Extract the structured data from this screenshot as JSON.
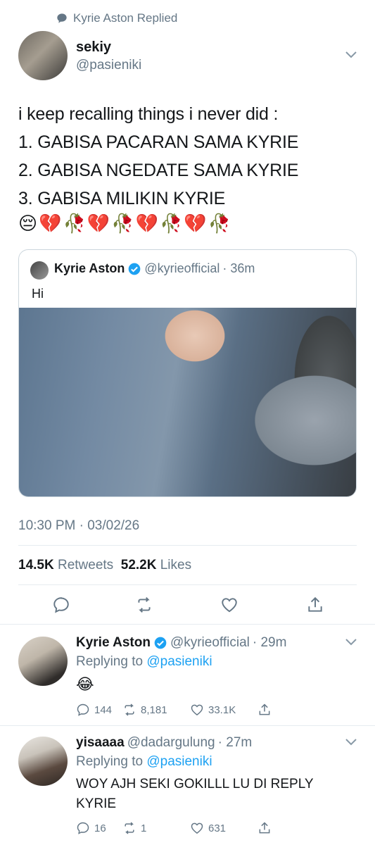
{
  "context": {
    "replied_label": "Kyrie Aston Replied"
  },
  "main_tweet": {
    "name": "sekiy",
    "handle": "@pasieniki",
    "lines": [
      "i keep recalling things i never did :",
      "1. GABISA PACARAN SAMA KYRIE",
      "2. GABISA NGEDATE SAMA KYRIE",
      "3. GABISA MILIKIN KYRIE"
    ],
    "emojis": "😔💔🥀💔🥀💔🥀💔🥀",
    "timestamp": "10:30 PM · 03/02/26",
    "retweets_count": "14.5K",
    "retweets_label": "Retweets",
    "likes_count": "52.2K",
    "likes_label": "Likes"
  },
  "quoted_tweet": {
    "name": "Kyrie Aston",
    "handle": "@kyrieofficial",
    "time": "· 36m",
    "text": "Hi"
  },
  "replies": [
    {
      "name": "Kyrie Aston",
      "handle": "@kyrieofficial",
      "time": "· 29m",
      "replying_prefix": "Replying to",
      "replying_to": "@pasieniki",
      "text": "😂",
      "comments": "144",
      "retweets": "8,181",
      "likes": "33.1K"
    },
    {
      "name": "yisaaaa",
      "handle": "@dadargulung",
      "time": "· 27m",
      "replying_prefix": "Replying to",
      "replying_to": "@pasieniki",
      "text_line1": "WOY AJH SEKI GOKILLL LU DI REPLY",
      "text_line2": "KYRIE",
      "comments": "16",
      "retweets": "1",
      "likes": "631"
    }
  ],
  "colors": {
    "accent": "#1da1f2",
    "secondary_text": "#657786",
    "primary_text": "#14171a",
    "divider": "#e6ecf0"
  },
  "icons": [
    "speech-bubble-icon",
    "chevron-down-icon",
    "verified-badge-icon",
    "reply-icon",
    "retweet-icon",
    "like-icon",
    "share-icon"
  ]
}
